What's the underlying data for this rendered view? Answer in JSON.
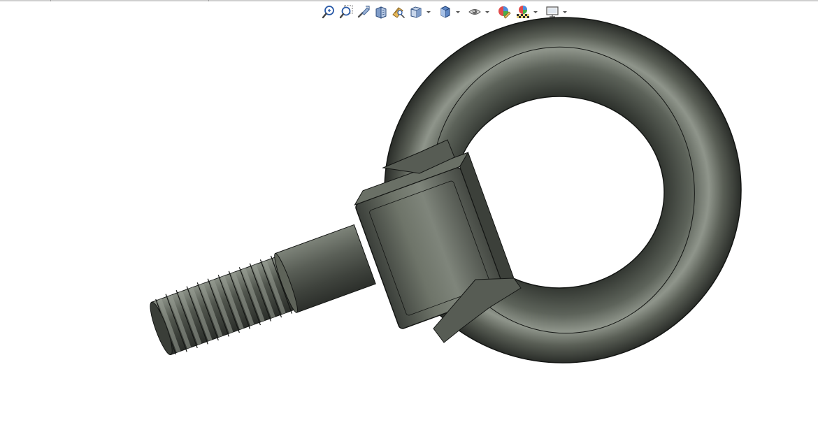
{
  "viewport": {
    "background": "#ffffff",
    "model_color": "#4a4f47",
    "model_highlight": "#9aa096",
    "model_edge": "#141614"
  },
  "toolbar": {
    "items": [
      {
        "icon": "zoom-to-fit-icon",
        "has_dropdown": false
      },
      {
        "icon": "zoom-to-area-icon",
        "has_dropdown": false
      },
      {
        "icon": "previous-view-icon",
        "has_dropdown": false
      },
      {
        "icon": "section-view-icon",
        "has_dropdown": false
      },
      {
        "icon": "dynamic-annotation-views-icon",
        "has_dropdown": false
      },
      {
        "icon": "view-orientation-icon",
        "has_dropdown": true
      },
      {
        "icon": "display-style-icon",
        "has_dropdown": true
      },
      {
        "icon": "hide-show-items-icon",
        "has_dropdown": true
      },
      {
        "icon": "edit-appearance-icon",
        "has_dropdown": false
      },
      {
        "icon": "apply-scene-icon",
        "has_dropdown": true
      },
      {
        "icon": "view-settings-icon",
        "has_dropdown": true
      }
    ]
  },
  "model": {
    "part": "eye-bolt"
  }
}
